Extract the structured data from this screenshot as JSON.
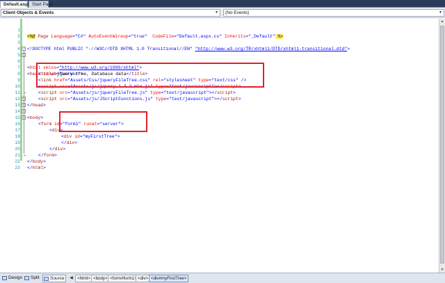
{
  "tabs": [
    {
      "label": "Default.aspx"
    },
    {
      "label": "Start Page"
    }
  ],
  "nav": {
    "left_combo": "Client Objects & Events",
    "right_combo": "(No Events)"
  },
  "line_numbers": [
    "1",
    "2",
    "3",
    "4",
    "5",
    "6",
    "7",
    "8",
    "9",
    "10",
    "11",
    "12",
    "13",
    "14",
    "15",
    "16",
    "17",
    "18",
    "19",
    "20",
    "21",
    "22",
    "23"
  ],
  "code": {
    "l1": {
      "open": "<%@",
      "page": " Page ",
      "a1": "Language",
      "eq1": "=",
      "v1": "\"C#\"",
      "a2": " AutoEventWireup",
      "eq2": "=",
      "v2": "\"true\"",
      "a3": "  CodeFile",
      "eq3": "=",
      "v3": "\"Default.aspx.cs\"",
      "a4": " Inherits",
      "eq4": "=",
      "v4": "\"_Default\"",
      "close": " %>"
    },
    "l3": {
      "doctype": "<!DOCTYPE html PUBLIC \"-//W3C//DTD XHTML 1.0 Transitional//EN\" ",
      "url": "\"http://www.w3.org/TR/xhtml1/DTD/xhtml1-transitional.dtd\"",
      "end": ">"
    },
    "l5": {
      "open": "<",
      "tag": "html",
      "attr": " xmlns",
      "eq": "=",
      "url": "\"http://www.w3.org/1999/xhtml\"",
      "close": ">"
    },
    "l6": {
      "open": "<",
      "tag": "head",
      "attr": " runat",
      "eq": "=",
      "val": "\"server\"",
      "close": ">"
    },
    "l7": {
      "open": "<",
      "tag": "title",
      "mid": ">",
      "text": "jQuery tree, Database data",
      "eopen": "</",
      "etag": "title",
      "close": ">"
    },
    "l8": {
      "open": "<",
      "tag": "link",
      "a1": " href",
      "eq1": "=",
      "v1": "\"Assets/Css/jqueryFileTree.css\"",
      "a2": " rel",
      "eq2": "=",
      "v2": "\"stylesheet\"",
      "a3": " type",
      "eq3": "=",
      "v3": "\"text/css\"",
      "close": " />"
    },
    "l9": {
      "open": "<",
      "tag": "script",
      "a1": " src",
      "eq1": "=",
      "v1": "\"Assets/js/jquery-1.3.2.min.js\"",
      "a2": " type",
      "eq2": "=",
      "v2": "\"text/javascript\"",
      "mid": "></",
      "etag": "script",
      "close": ">"
    },
    "l10": {
      "open": "<",
      "tag": "script",
      "a1": " src",
      "eq1": "=",
      "v1": "\"Assets/js/jqueryFileTree.js\"",
      "a2": " type",
      "eq2": "=",
      "v2": "\"text/javascript\"",
      "mid": "></",
      "etag": "script",
      "close": ">"
    },
    "l11": {
      "open": "<",
      "tag": "script",
      "a1": " src",
      "eq1": "=",
      "v1": "\"Assets/js/JScriptFunctions.js\"",
      "a2": " type",
      "eq2": "=",
      "v2": "\"text/javascript\"",
      "mid": "></",
      "etag": "script",
      "close": ">"
    },
    "l12": {
      "open": "</",
      "tag": "head",
      "close": ">"
    },
    "l13": {
      "open": "<",
      "tag": "body",
      "close": ">"
    },
    "l14": {
      "open": "<",
      "tag": "form",
      "a1": " id",
      "eq1": "=",
      "v1": "\"form1\"",
      "a2": " runat",
      "eq2": "=",
      "v2": "\"server\"",
      "close": ">"
    },
    "l15": {
      "open": "<",
      "tag": "div",
      "close": ">"
    },
    "l16": {
      "open": "<",
      "tag": "div",
      "a1": " id",
      "eq1": "=",
      "v1": "\"myFirstTree\"",
      "close": ">"
    },
    "l18": {
      "open": "</",
      "tag": "div",
      "close": ">"
    },
    "l19": {
      "open": "</",
      "tag": "div",
      "close": ">"
    },
    "l20": {
      "open": "</",
      "tag": "form",
      "close": ">"
    },
    "l21": {
      "open": "</",
      "tag": "body",
      "close": ">"
    },
    "l22": {
      "open": "</",
      "tag": "html",
      "close": ">"
    }
  },
  "bottom": {
    "design": "Design",
    "split": "Split",
    "source": "Source",
    "crumbs": [
      "<html>",
      "<body>",
      "<form#form1>",
      "<div>",
      "<div#myFirstTree>"
    ]
  },
  "colors": {
    "tag": "#a31515",
    "attribute": "#ff0000",
    "value": "#0000ff",
    "highlight_box": "#e0202a",
    "line_number": "#2b91af"
  }
}
